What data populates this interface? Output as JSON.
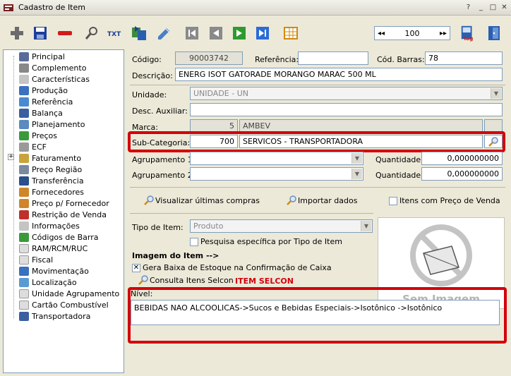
{
  "window": {
    "title": "Cadastro de Item",
    "controls": [
      "?",
      "_",
      "□",
      "✕"
    ]
  },
  "toolbar": {
    "icons": [
      "add-icon",
      "save-icon",
      "delete-icon",
      "search-icon",
      "txt-export-icon",
      "refresh-icon",
      "edit-icon",
      "first-record-icon",
      "previous-record-icon",
      "next-record-icon",
      "last-record-icon",
      "grid-icon",
      "log-icon",
      "exit-icon"
    ],
    "nav": {
      "prev": "◂◂",
      "value": "100",
      "next": "▸▸"
    },
    "log_label": "log"
  },
  "tree": {
    "items": [
      "Principal",
      "Complemento",
      "Características",
      "Produção",
      "Referência",
      "Balança",
      "Planejamento",
      "Preços",
      "ECF",
      "Faturamento",
      "Preço Região",
      "Transferência",
      "Fornecedores",
      "Preço p/ Fornecedor",
      "Restrição de Venda",
      "Informações",
      "Códigos de Barra",
      "RAM/RCM/RUC",
      "Fiscal",
      "Movimentação",
      "Localização",
      "Unidade Agrupamento",
      "Cartão Combustível",
      "Transportadora"
    ]
  },
  "form": {
    "codigo_label": "Código:",
    "codigo_value": "90003742",
    "referencia_label": "Referência:",
    "referencia_value": "",
    "cod_barras_label": "Cód. Barras:",
    "cod_barras_value": "78",
    "descricao_label": "Descrição:",
    "descricao_value": "ENERG ISOT GATORADE MORANGO MARAC 500 ML",
    "unidade_label": "Unidade:",
    "unidade_value": "UNIDADE - UN",
    "desc_aux_label": "Desc. Auxiliar:",
    "desc_aux_value": "",
    "marca_label": "Marca:",
    "marca_code": "5",
    "marca_name": "AMBEV",
    "subcat_label": "Sub-Categoria:",
    "subcat_code": "700",
    "subcat_name": "SERVICOS - TRANSPORTADORA",
    "agrup1_label": "Agrupamento 1:",
    "agrup2_label": "Agrupamento 2:",
    "quantidade_label": "Quantidade:",
    "quantidade1_value": "0,000000000",
    "quantidade2_value": "0,000000000",
    "visualizar_label": "Visualizar últimas compras",
    "importar_label": "Importar dados",
    "itens_preco_label": "Itens com Preço de Venda",
    "tipo_item_label": "Tipo de Item:",
    "tipo_item_value": "Produto",
    "pesquisa_tipo_label": "Pesquisa específica por Tipo de Item",
    "imagem_label": "Imagem do Item -->",
    "gera_baixa_label": "Gera Baixa de Estoque na Confirmação de Caixa",
    "consulta_selcon_label": "Consulta Itens Selcon",
    "item_selcon_label": "ITEM SELCON",
    "nivel_label": "Nível:",
    "nivel_value": "BEBIDAS NAO ALCOOLICAS->Sucos e Bebidas Especiais->Isotônico ->Isotônico",
    "sem_imagem_label": "Sem Imagem"
  },
  "colors": {
    "highlight": "#d3000b",
    "item_selcon": "#d3000b"
  }
}
